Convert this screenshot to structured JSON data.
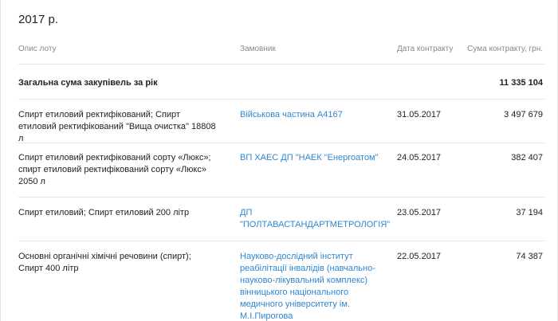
{
  "year_title": "2017 р.",
  "columns": {
    "description": "Опис лоту",
    "customer": "Замовник",
    "date": "Дата контракту",
    "sum": "Сума контракту, грн."
  },
  "total": {
    "label": "Загальна сума закупівель за рік",
    "value": "11 335 104"
  },
  "rows": [
    {
      "description": "Спирт етиловий ректифікований; Спирт етиловий ректифікований \"Вища очистка\" 18808 л",
      "customer": "Військова частина А4167",
      "date": "31.05.2017",
      "amount": "3 497 679"
    },
    {
      "description": "Спирт етиловий ректифікований сорту «Люкс»; спирт етиловий ректифікований сорту «Люкс» 2050 л",
      "customer": "ВП ХАЕС ДП \"НАЕК \"Енергоатом\"",
      "date": "24.05.2017",
      "amount": "382 407"
    },
    {
      "description": "Спирт етиловий; Спирт етиловий 200 літр",
      "customer": "ДП \"ПОЛТАВАСТАНДАРТМЕТРОЛОГІЯ\"",
      "date": "23.05.2017",
      "amount": "37 194"
    },
    {
      "description": "Основні органічні хімічні речовини (спирт); Спирт 400 літр",
      "customer": "Науково-дослідний інститут реабілітації інвалідів (навчально-науково-лікувальний комплекс) вінницького національного медичного університету ім. М.І.Пирогова",
      "date": "22.05.2017",
      "amount": "74 387"
    }
  ]
}
